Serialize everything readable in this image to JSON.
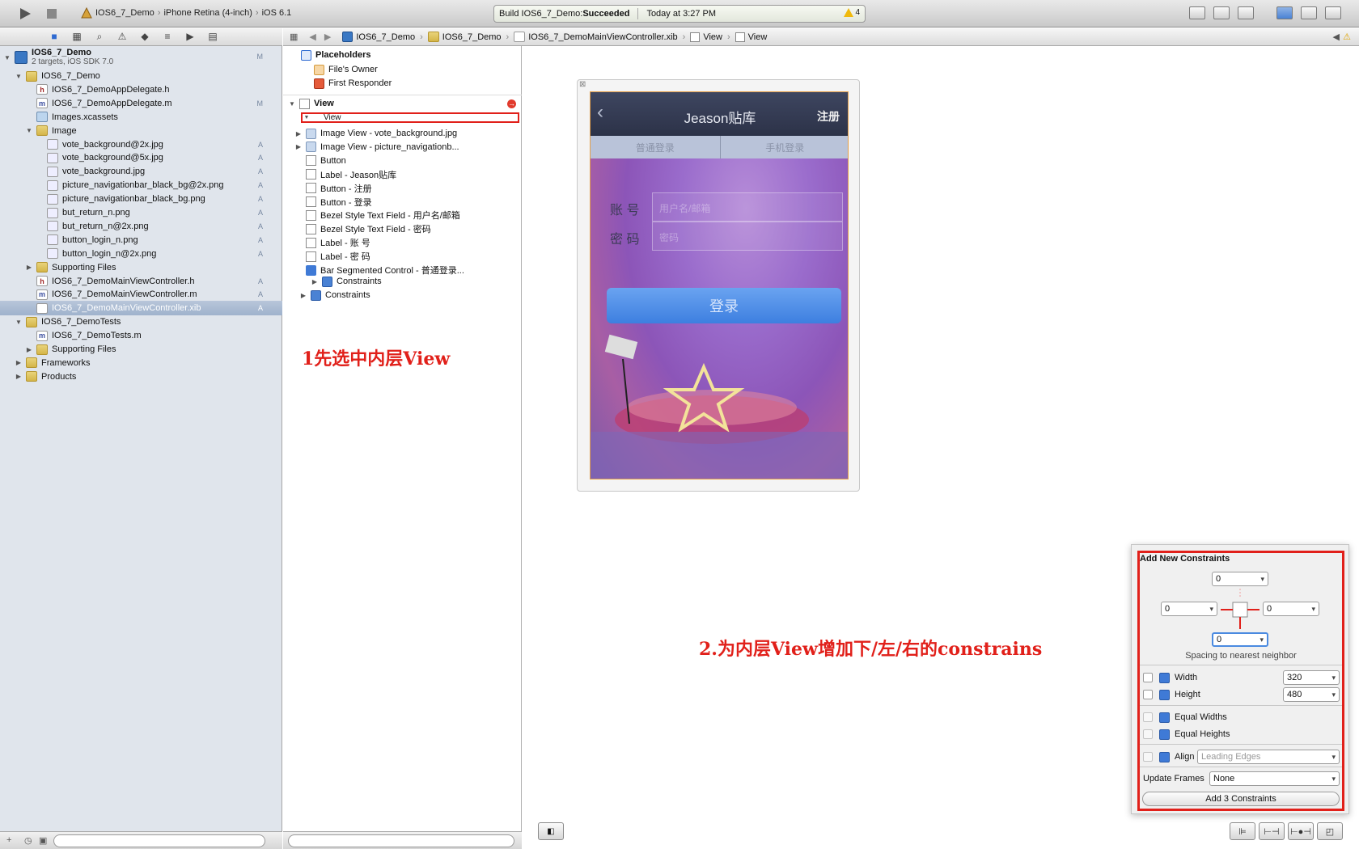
{
  "toolbar": {
    "scheme_project": "IOS6_7_Demo",
    "scheme_device": "iPhone Retina (4-inch)",
    "scheme_sdk": "iOS 6.1",
    "status_prefix": "Build IOS6_7_Demo: ",
    "status_result": "Succeeded",
    "status_time": "Today at 3:27 PM",
    "warning_count": "4"
  },
  "navigator": {
    "project_name": "IOS6_7_Demo",
    "project_sub": "2 targets, iOS SDK 7.0",
    "items": [
      {
        "label": "IOS6_7_Demo",
        "type": "folder",
        "badge": ""
      },
      {
        "label": "IOS6_7_DemoAppDelegate.h",
        "type": "h",
        "badge": ""
      },
      {
        "label": "IOS6_7_DemoAppDelegate.m",
        "type": "m",
        "badge": "M"
      },
      {
        "label": "Images.xcassets",
        "type": "xcassets",
        "badge": ""
      },
      {
        "label": "Image",
        "type": "folder",
        "badge": ""
      },
      {
        "label": "vote_background@2x.jpg",
        "type": "img",
        "badge": "A"
      },
      {
        "label": "vote_background@5x.jpg",
        "type": "img",
        "badge": "A"
      },
      {
        "label": "vote_background.jpg",
        "type": "img",
        "badge": "A"
      },
      {
        "label": "picture_navigationbar_black_bg@2x.png",
        "type": "img",
        "badge": "A"
      },
      {
        "label": "picture_navigationbar_black_bg.png",
        "type": "img",
        "badge": "A"
      },
      {
        "label": "but_return_n.png",
        "type": "img",
        "badge": "A"
      },
      {
        "label": "but_return_n@2x.png",
        "type": "img",
        "badge": "A"
      },
      {
        "label": "button_login_n.png",
        "type": "img",
        "badge": "A"
      },
      {
        "label": "button_login_n@2x.png",
        "type": "img",
        "badge": "A"
      },
      {
        "label": "Supporting Files",
        "type": "folder",
        "badge": ""
      },
      {
        "label": "IOS6_7_DemoMainViewController.h",
        "type": "h",
        "badge": "A"
      },
      {
        "label": "IOS6_7_DemoMainViewController.m",
        "type": "m",
        "badge": "A"
      },
      {
        "label": "IOS6_7_DemoMainViewController.xib",
        "type": "xib",
        "badge": "A"
      },
      {
        "label": "IOS6_7_DemoTests",
        "type": "folder",
        "badge": ""
      },
      {
        "label": "IOS6_7_DemoTests.m",
        "type": "m",
        "badge": ""
      },
      {
        "label": "Supporting Files",
        "type": "folder",
        "badge": ""
      },
      {
        "label": "Frameworks",
        "type": "folder",
        "badge": ""
      },
      {
        "label": "Products",
        "type": "folder",
        "badge": ""
      }
    ]
  },
  "jumpbar": {
    "crumbs": [
      "IOS6_7_Demo",
      "IOS6_7_Demo",
      "IOS6_7_DemoMainViewController.xib",
      "View",
      "View"
    ]
  },
  "outline": {
    "placeholders": "Placeholders",
    "files_owner": "File's Owner",
    "first_responder": "First Responder",
    "view_header": "View",
    "inner_view": "View",
    "children": [
      "Image View - vote_background.jpg",
      "Image View - picture_navigationb...",
      "Button",
      "Label - Jeason贴库",
      "Button - 注册",
      "Button - 登录",
      "Bezel Style Text Field - 用户名/邮箱",
      "Bezel Style Text Field - 密码",
      "Label - 账 号",
      "Label - 密 码",
      "Bar Segmented Control - 普通登录..."
    ],
    "inner_constraints": "Constraints",
    "outer_constraints": "Constraints"
  },
  "phone": {
    "title": "Jeason贴库",
    "register": "注册",
    "segment_left": "普通登录",
    "segment_right": "手机登录",
    "account_label": "账 号",
    "password_label": "密 码",
    "account_placeholder": "用户名/邮箱",
    "password_placeholder": "密码",
    "login": "登录"
  },
  "annotations": {
    "step1": "1先选中内层View",
    "step2": "2.为内层View增加下/左/右的constrains"
  },
  "constraints_popover": {
    "title": "Add New Constraints",
    "top": "0",
    "left": "0",
    "right": "0",
    "bottom": "0",
    "spacing_label": "Spacing to nearest neighbor",
    "width_label": "Width",
    "width_value": "320",
    "height_label": "Height",
    "height_value": "480",
    "equal_widths": "Equal Widths",
    "equal_heights": "Equal Heights",
    "align_label": "Align",
    "align_value": "Leading Edges",
    "update_frames_label": "Update Frames",
    "update_frames_value": "None",
    "add_button": "Add 3 Constraints"
  },
  "colors": {
    "annotation": "#e1201a",
    "selection": "#9fb2cc",
    "accent": "#3f7ad6"
  }
}
